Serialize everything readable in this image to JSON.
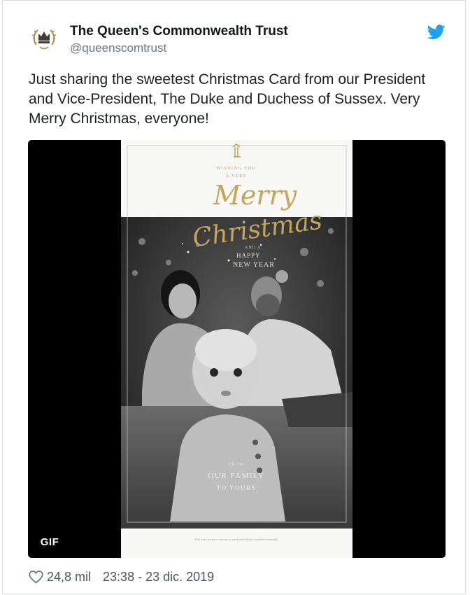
{
  "author": {
    "name": "The Queen's Commonwealth Trust",
    "handle": "@queenscomtrust"
  },
  "tweet": {
    "text": "Just sharing the sweetest Christmas Card from our President and Vice-President, The Duke and Duchess of Sussex. Very Merry Christmas, everyone!"
  },
  "media": {
    "badge": "GIF",
    "card": {
      "greeting_small_1": "WISHING YOU",
      "greeting_small_2": "A VERY",
      "merry": "Merry",
      "christmas": "Christmas",
      "and_a": "AND A",
      "happy": "HAPPY",
      "new_year": "NEW YEAR",
      "from": "FROM",
      "our_family": "OUR FAMILY",
      "to_yours": "TO YOURS",
      "footer": "This year we have chosen to send our holiday card electronically."
    }
  },
  "engagement": {
    "likes": "24,8 mil",
    "timestamp": "23:38 - 23 dic. 2019"
  },
  "colors": {
    "twitter_blue": "#1da1f2",
    "gold": "#b99a4a"
  },
  "icons": {
    "logo": "twitter-bird-icon",
    "like": "heart-icon",
    "avatar": "crown-crest-icon"
  }
}
